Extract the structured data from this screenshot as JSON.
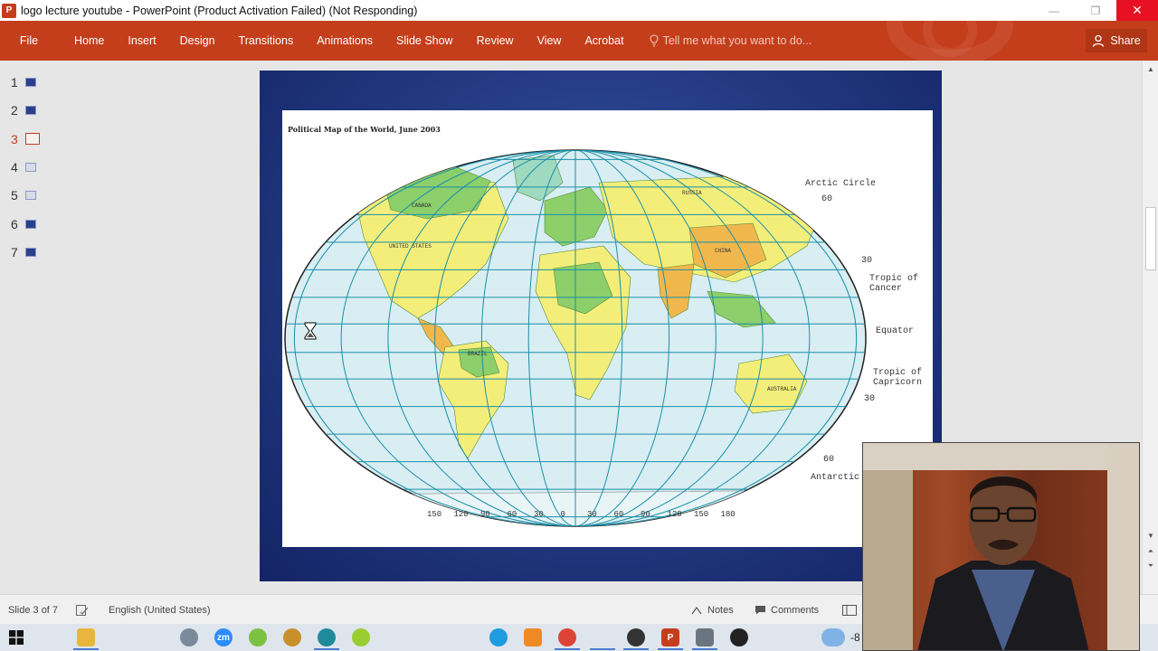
{
  "window": {
    "title": "logo lecture youtube - PowerPoint (Product Activation Failed) (Not Responding)",
    "app_icon_letter": "P",
    "controls": {
      "minimize": "—",
      "restore": "❐",
      "close": "✕"
    }
  },
  "ribbon": {
    "file_label": "File",
    "tabs": [
      "Home",
      "Insert",
      "Design",
      "Transitions",
      "Animations",
      "Slide Show",
      "Review",
      "View",
      "Acrobat"
    ],
    "tell_me_placeholder": "Tell me what you want to do...",
    "share_label": "Share"
  },
  "thumbnails": [
    {
      "number": "1",
      "style": "dark"
    },
    {
      "number": "2",
      "style": "dark"
    },
    {
      "number": "3",
      "style": "active"
    },
    {
      "number": "4",
      "style": "light"
    },
    {
      "number": "5",
      "style": "light"
    },
    {
      "number": "6",
      "style": "dark"
    },
    {
      "number": "7",
      "style": "dark"
    }
  ],
  "slide": {
    "map_title": "Political Map of the World, June 2003",
    "labels": {
      "arctic_circle": "Arctic Circle",
      "lat_60_top": "60",
      "lat_30_top": "30",
      "tropic_cancer": "Tropic of\nCancer",
      "equator": "Equator",
      "tropic_capricorn": "Tropic of\nCapricorn",
      "lat_30_bottom": "30",
      "lat_60_bottom": "60",
      "antarctic": "Antarctic",
      "continents": [
        "RUSSIA",
        "CANADA",
        "UNITED STATES",
        "BRAZIL",
        "AUSTRALIA",
        "CHINA"
      ],
      "longitudes": [
        "150",
        "120",
        "90",
        "60",
        "30",
        "0",
        "30",
        "60",
        "90",
        "120",
        "150",
        "180"
      ]
    }
  },
  "statusbar": {
    "slide_position": "Slide 3 of 7",
    "language": "English (United States)",
    "notes_label": "Notes",
    "comments_label": "Comments"
  },
  "taskbar": {
    "weather_text": "-8",
    "colors": {
      "accent": "#4a7bd0"
    }
  },
  "colors": {
    "ribbon": "#c43e1c",
    "slide_background": "#22387f",
    "ocean": "#d8eef2",
    "grid": "#1a8fa8",
    "land_yellow": "#f3ee7a",
    "land_green": "#8ccf6b",
    "land_orange": "#f0b84c"
  }
}
